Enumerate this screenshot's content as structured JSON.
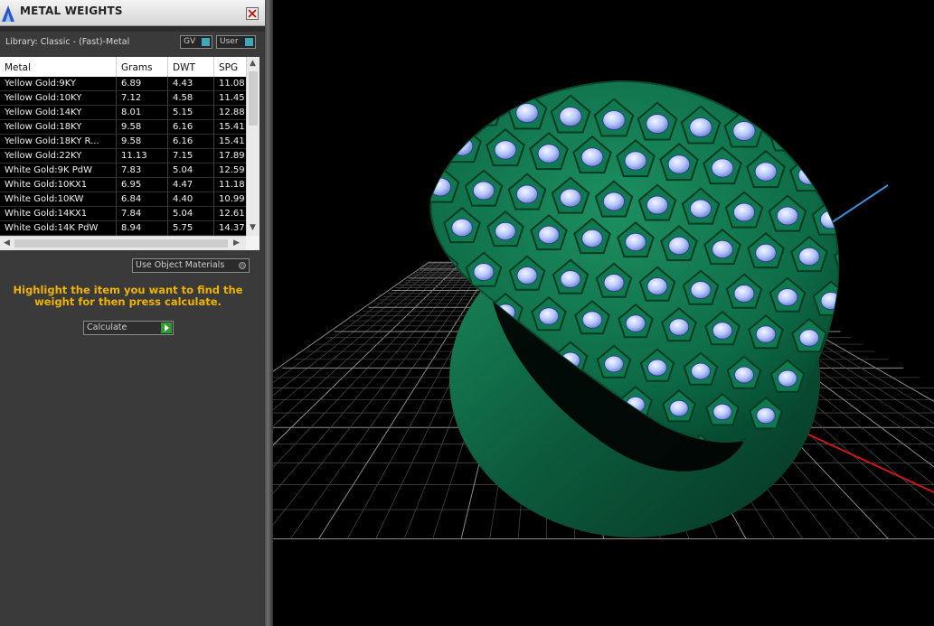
{
  "panel": {
    "title": "METAL WEIGHTS",
    "library": "Library: Classic - (Fast)-Metal",
    "toggle_gv": "GV",
    "toggle_user": "User",
    "use_object_materials": "Use Object Materials",
    "hint": "Highlight the item you want to find the weight for then press calculate.",
    "calculate_label": "Calculate"
  },
  "table": {
    "columns": [
      "Metal",
      "Grams",
      "DWT",
      "SPG"
    ],
    "rows": [
      [
        "Yellow Gold:9KY",
        "6.89",
        "4.43",
        "11.08"
      ],
      [
        "Yellow Gold:10KY",
        "7.12",
        "4.58",
        "11.45"
      ],
      [
        "Yellow Gold:14KY",
        "8.01",
        "5.15",
        "12.88"
      ],
      [
        "Yellow Gold:18KY",
        "9.58",
        "6.16",
        "15.41"
      ],
      [
        "Yellow Gold:18KY R...",
        "9.58",
        "6.16",
        "15.41"
      ],
      [
        "Yellow Gold:22KY",
        "11.13",
        "7.15",
        "17.89"
      ],
      [
        "White Gold:9K PdW",
        "7.83",
        "5.04",
        "12.59"
      ],
      [
        "White Gold:10KX1",
        "6.95",
        "4.47",
        "11.18"
      ],
      [
        "White Gold:10KW",
        "6.84",
        "4.40",
        "10.99"
      ],
      [
        "White Gold:14KX1",
        "7.84",
        "5.04",
        "12.61"
      ],
      [
        "White Gold:14K PdW",
        "8.94",
        "5.75",
        "14.37"
      ]
    ]
  },
  "colors": {
    "panel_bg": "#3a3a3a",
    "accent_text": "#f0b400",
    "ring_green": "#0e6b45",
    "gem_blue": "#b8c8ff",
    "viewport_bg": "#000000"
  }
}
